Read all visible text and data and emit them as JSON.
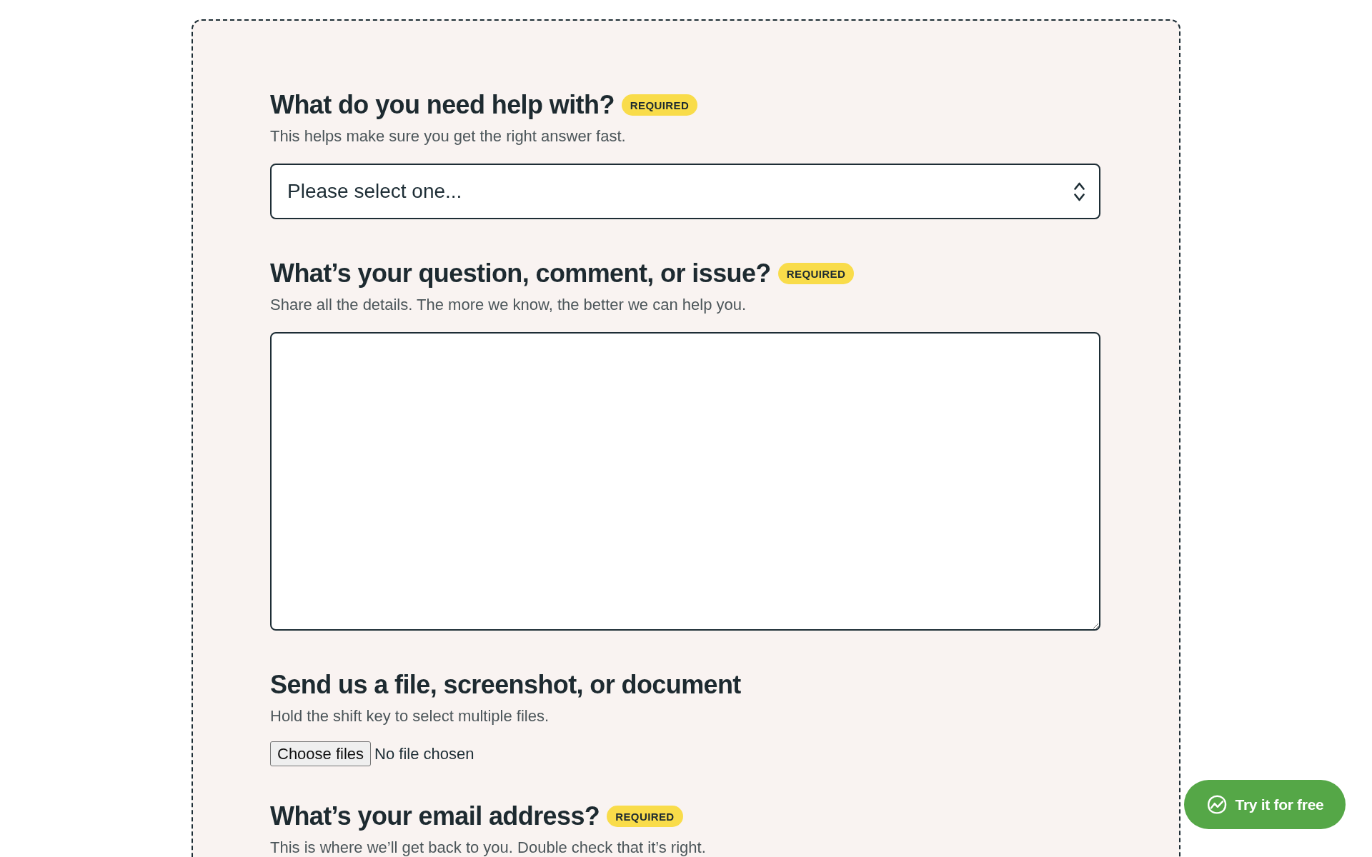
{
  "form": {
    "fields": [
      {
        "kind": "select",
        "label": "What do you need help with?",
        "badge": "REQUIRED",
        "hint": "This helps make sure you get the right answer fast.",
        "placeholder": "Please select one..."
      },
      {
        "kind": "textarea",
        "label": "What’s your question, comment, or issue?",
        "badge": "REQUIRED",
        "hint": "Share all the details. The more we know, the better we can help you."
      },
      {
        "kind": "file",
        "label": "Send us a file, screenshot, or document",
        "hint": "Hold the shift key to select multiple files.",
        "button": "Choose files",
        "status": "No file chosen"
      },
      {
        "kind": "email",
        "label": "What’s your email address?",
        "badge": "REQUIRED",
        "hint": "This is where we’ll get back to you. Double check that it’s right."
      }
    ]
  },
  "cta_button": {
    "label": "Try it for free"
  }
}
